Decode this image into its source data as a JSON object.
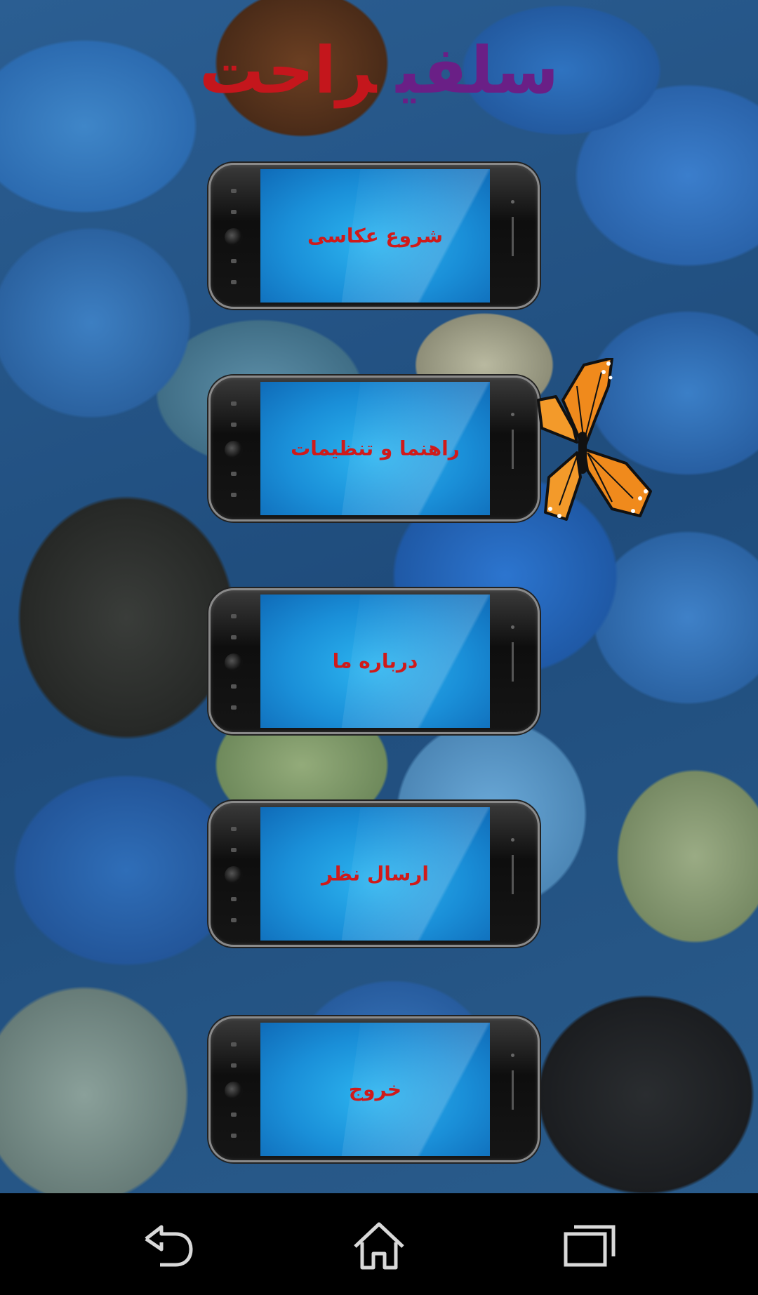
{
  "app": {
    "title_word1": "سلفی",
    "title_word2": "راحت",
    "title_colors": {
      "word1": "#6a1f86",
      "word2": "#c4161c"
    }
  },
  "menu": {
    "items": [
      {
        "id": "start",
        "label": "شروع عکاسی"
      },
      {
        "id": "help",
        "label": "راهنما و تنظیمات"
      },
      {
        "id": "about",
        "label": "درباره ما"
      },
      {
        "id": "feedback",
        "label": "ارسال نظر"
      },
      {
        "id": "exit",
        "label": "خروج"
      }
    ],
    "label_color": "#d01a1a"
  },
  "decor": {
    "butterfly": "butterfly-icon"
  },
  "navbar": {
    "buttons": [
      {
        "name": "back-icon"
      },
      {
        "name": "home-icon"
      },
      {
        "name": "recents-icon"
      }
    ]
  }
}
